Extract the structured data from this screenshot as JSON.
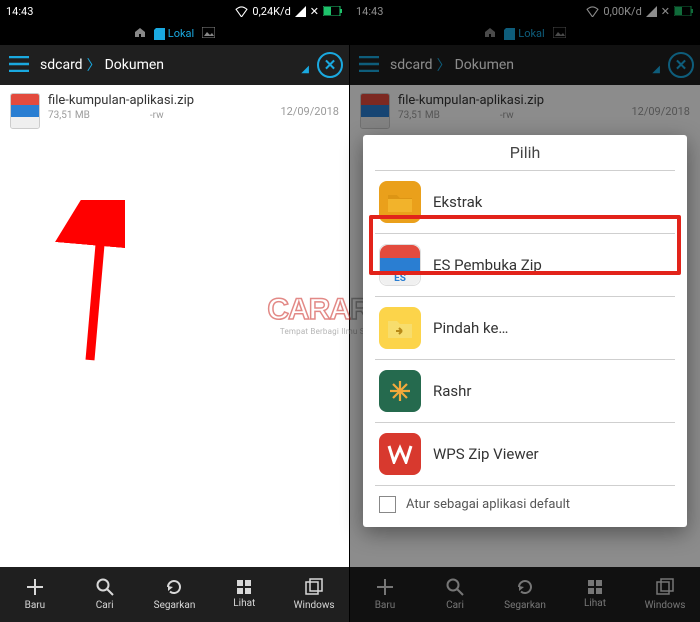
{
  "status": {
    "time": "14:43",
    "speed_left": "0,24K/d",
    "speed_right": "0,00K/d"
  },
  "tabbar": {
    "active": "Lokal"
  },
  "breadcrumb": {
    "root": "sdcard",
    "current": "Dokumen"
  },
  "file": {
    "name": "file-kumpulan-aplikasi.zip",
    "size": "73,51 MB",
    "perm": "-rw",
    "date": "12/09/2018"
  },
  "bottom": {
    "baru": "Baru",
    "cari": "Cari",
    "segarkan": "Segarkan",
    "lihat": "Lihat",
    "windows": "Windows"
  },
  "dialog": {
    "title": "Pilih",
    "options": {
      "ekstrak": "Ekstrak",
      "es": "ES Pembuka Zip",
      "pindah": "Pindah ke…",
      "rashr": "Rashr",
      "wps": "WPS Zip Viewer"
    },
    "default_label": "Atur sebagai aplikasi default"
  },
  "watermark": {
    "brand1": "CARA",
    "brand2": "ROOT",
    "tagline": "Tempat Berbagi Ilmu Seputar Android"
  }
}
